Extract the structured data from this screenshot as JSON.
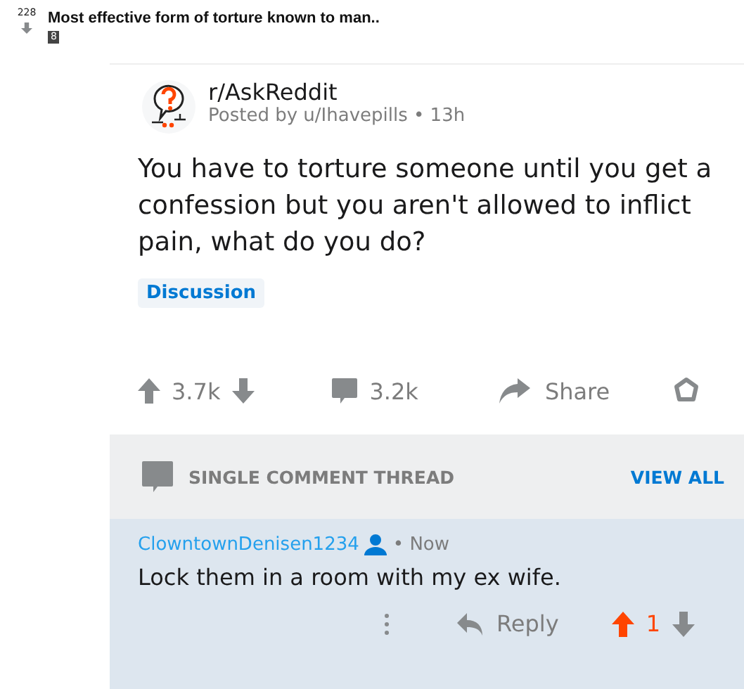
{
  "post": {
    "score": "228",
    "title": "Most effective form of torture known to man..",
    "badge": "8"
  },
  "embed": {
    "subreddit": "r/AskReddit",
    "meta": "Posted by u/Ihavepills • 13h",
    "title": "You have to torture someone until you get a confession but you aren't allowed to inflict pain, what do you do?",
    "flair": "Discussion",
    "votes": "3.7k",
    "comments": "3.2k",
    "share": "Share"
  },
  "thread": {
    "label": "SINGLE COMMENT THREAD",
    "link": "VIEW ALL"
  },
  "comment": {
    "author": "ClowntownDenisen1234",
    "time": "• Now",
    "body": "Lock them in a room with my ex wife.",
    "reply": "Reply",
    "score": "1",
    "upvoted": true
  }
}
